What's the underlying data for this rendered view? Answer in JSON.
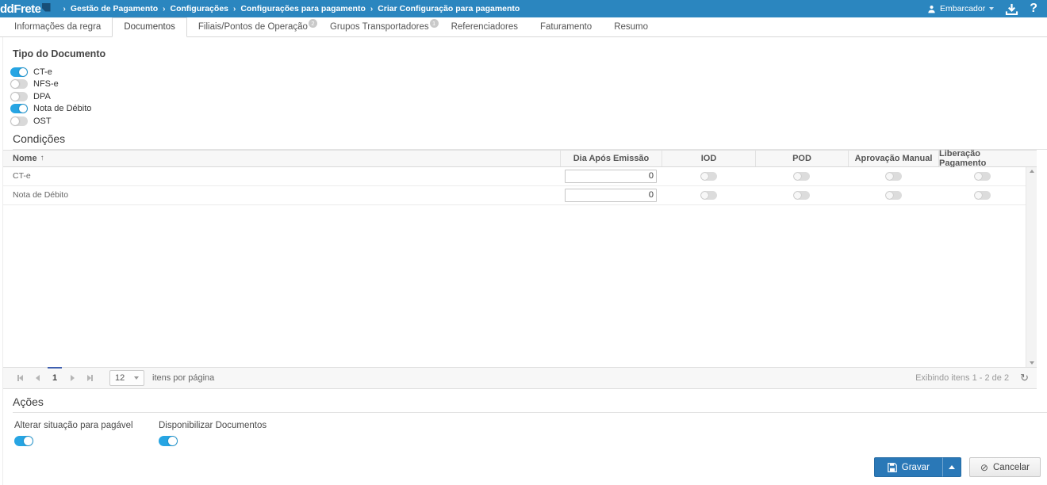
{
  "colors": {
    "topbar": "#2b86bf",
    "toggle-on": "#27a5e3",
    "btn-blue": "#2a78b7"
  },
  "topbar": {
    "logo_text": "ddFrete",
    "breadcrumb": [
      "Gestão de Pagamento",
      "Configurações",
      "Configurações para pagamento",
      "Criar Configuração para pagamento"
    ],
    "user_menu": "Embarcador",
    "help_label": "?"
  },
  "tabs": {
    "active": "Documentos",
    "items": [
      {
        "label": "Informações da regra"
      },
      {
        "label": "Documentos"
      },
      {
        "label": "Filiais/Pontos de Operação",
        "badge": "2"
      },
      {
        "label": "Grupos Transportadores",
        "badge": "1"
      },
      {
        "label": "Referenciadores"
      },
      {
        "label": "Faturamento"
      },
      {
        "label": "Resumo"
      }
    ]
  },
  "document_types": {
    "title": "Tipo do Documento",
    "items": [
      {
        "label": "CT-e",
        "on": true
      },
      {
        "label": "NFS-e",
        "on": false
      },
      {
        "label": "DPA",
        "on": false
      },
      {
        "label": "Nota de Débito",
        "on": true
      },
      {
        "label": "OST",
        "on": false
      }
    ]
  },
  "conditions": {
    "title": "Condições",
    "columns": [
      "Nome",
      "Dia Após Emissão",
      "IOD",
      "POD",
      "Aprovação Manual",
      "Liberação Pagamento"
    ],
    "rows": [
      {
        "nome": "CT-e",
        "dia_apos_emissao": "0",
        "iod": false,
        "pod": false,
        "aprovacao_manual": false,
        "liberacao_pagamento": false
      },
      {
        "nome": "Nota de Débito",
        "dia_apos_emissao": "0",
        "iod": false,
        "pod": false,
        "aprovacao_manual": false,
        "liberacao_pagamento": false
      }
    ],
    "pagination": {
      "page": "1",
      "page_size": "12",
      "per_page_label": "itens por página",
      "status": "Exibindo itens 1 - 2 de 2"
    }
  },
  "actions": {
    "title": "Ações",
    "items": [
      {
        "label": "Alterar situação para pagável",
        "on": true
      },
      {
        "label": "Disponibilizar Documentos",
        "on": true
      }
    ]
  },
  "footer": {
    "save_label": "Gravar",
    "cancel_label": "Cancelar"
  },
  "icons": {
    "refresh": "↻",
    "cancel": "⊘",
    "sort_asc": "↑"
  }
}
